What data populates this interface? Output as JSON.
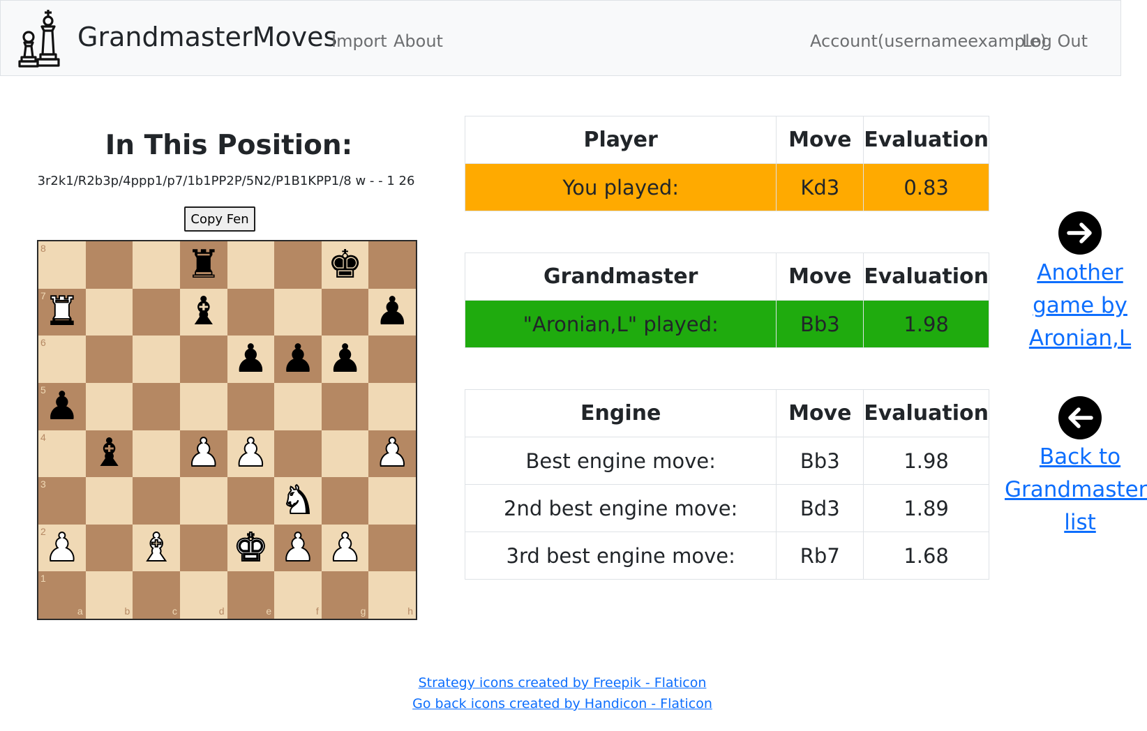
{
  "navbar": {
    "brand": "GrandmasterMoves",
    "links": [
      "Import",
      "About"
    ],
    "account": "Account(usernameexample)",
    "logout": "Log Out"
  },
  "position": {
    "title": "In This Position:",
    "fen": "3r2k1/R2b3p/4ppp1/p7/1b1PP2P/5N2/P1B1KPP1/8 w - - 1 26",
    "copy_label": "Copy Fen"
  },
  "board": {
    "fen_placement": "3r2k1/R2b3p/4ppp1/p7/1b1PP2P/5N2/P1B1KPP1/8",
    "files": [
      "a",
      "b",
      "c",
      "d",
      "e",
      "f",
      "g",
      "h"
    ],
    "ranks": [
      "8",
      "7",
      "6",
      "5",
      "4",
      "3",
      "2",
      "1"
    ],
    "light_color": "#f0d9b5",
    "dark_color": "#b58863"
  },
  "player_table": {
    "headers": [
      "Player",
      "Move",
      "Evaluation"
    ],
    "row": {
      "label": "You played:",
      "move": "Kd3",
      "eval": "0.83"
    },
    "highlight_color": "#ffaa00"
  },
  "gm_table": {
    "headers": [
      "Grandmaster",
      "Move",
      "Evaluation"
    ],
    "row": {
      "label": "\"Aronian,L\" played:",
      "move": "Bb3",
      "eval": "1.98"
    },
    "highlight_color": "#1fab0e"
  },
  "engine_table": {
    "headers": [
      "Engine",
      "Move",
      "Evaluation"
    ],
    "rows": [
      {
        "label": "Best engine move:",
        "move": "Bb3",
        "eval": "1.98"
      },
      {
        "label": "2nd best engine move:",
        "move": "Bd3",
        "eval": "1.89"
      },
      {
        "label": "3rd best engine move:",
        "move": "Rb7",
        "eval": "1.68"
      }
    ]
  },
  "side_nav": {
    "another_game": [
      "Another",
      "game by",
      "Aronian,L"
    ],
    "another_icon": "arrow-right-circle-icon",
    "back": [
      "Back to",
      "Grandmasters",
      "list"
    ],
    "back_icon": "arrow-left-circle-icon"
  },
  "footer": {
    "credit1": "Strategy icons created by Freepik - Flaticon",
    "credit2": "Go back icons created by Handicon - Flaticon"
  }
}
